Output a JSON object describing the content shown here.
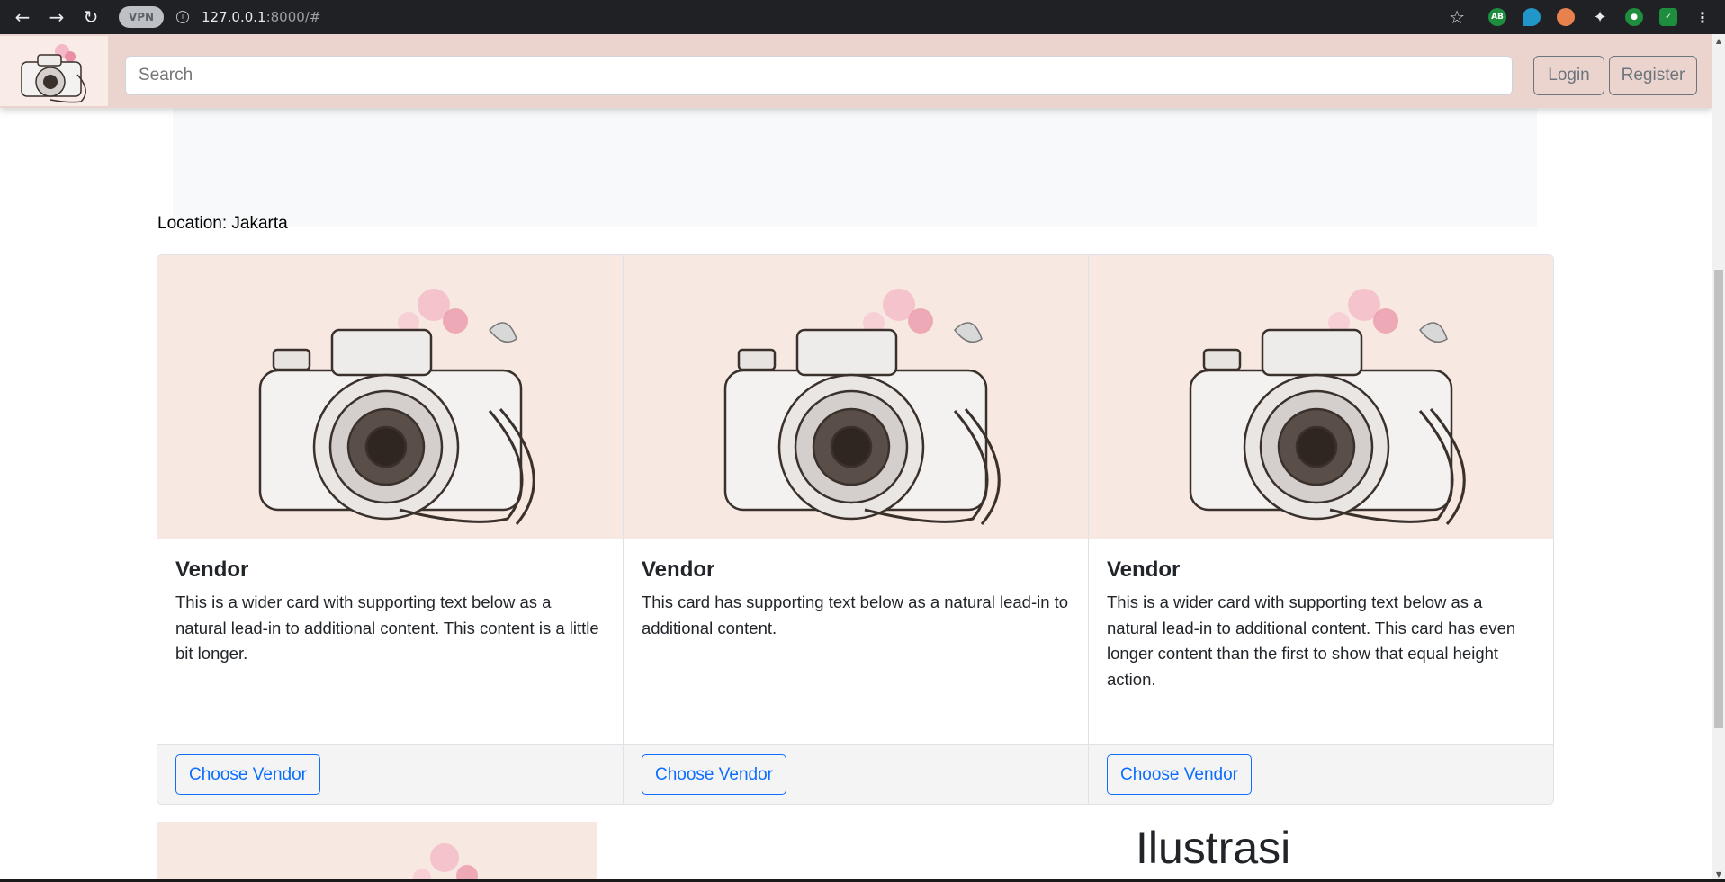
{
  "browser": {
    "url_host": "127.0.0.1",
    "url_rest": ":8000/#",
    "vpn_label": "VPN",
    "ext_ab_label": "AB"
  },
  "navbar": {
    "search_placeholder": "Search",
    "login_label": "Login",
    "register_label": "Register"
  },
  "location": {
    "label": "Location: Jakarta"
  },
  "cards": [
    {
      "title": "Vendor",
      "text": "This is a wider card with supporting text below as a natural lead-in to additional content. This content is a little bit longer.",
      "button": "Choose Vendor"
    },
    {
      "title": "Vendor",
      "text": "This card has supporting text below as a natural lead-in to additional content.",
      "button": "Choose Vendor"
    },
    {
      "title": "Vendor",
      "text": "This is a wider card with supporting text below as a natural lead-in to additional content. This card has even longer content than the first to show that equal height action.",
      "button": "Choose Vendor"
    }
  ],
  "section": {
    "title": "Ilustrasi"
  },
  "colors": {
    "navbar_bg": "#ecd4ce",
    "card_image_bg": "#f8e8e2",
    "primary": "#0d6efd",
    "secondary": "#6c757d"
  },
  "icons": [
    "back-icon",
    "forward-icon",
    "reload-icon",
    "info-icon",
    "star-icon",
    "puzzle-icon",
    "profile-icon",
    "menu-icon",
    "camera-illustration"
  ]
}
